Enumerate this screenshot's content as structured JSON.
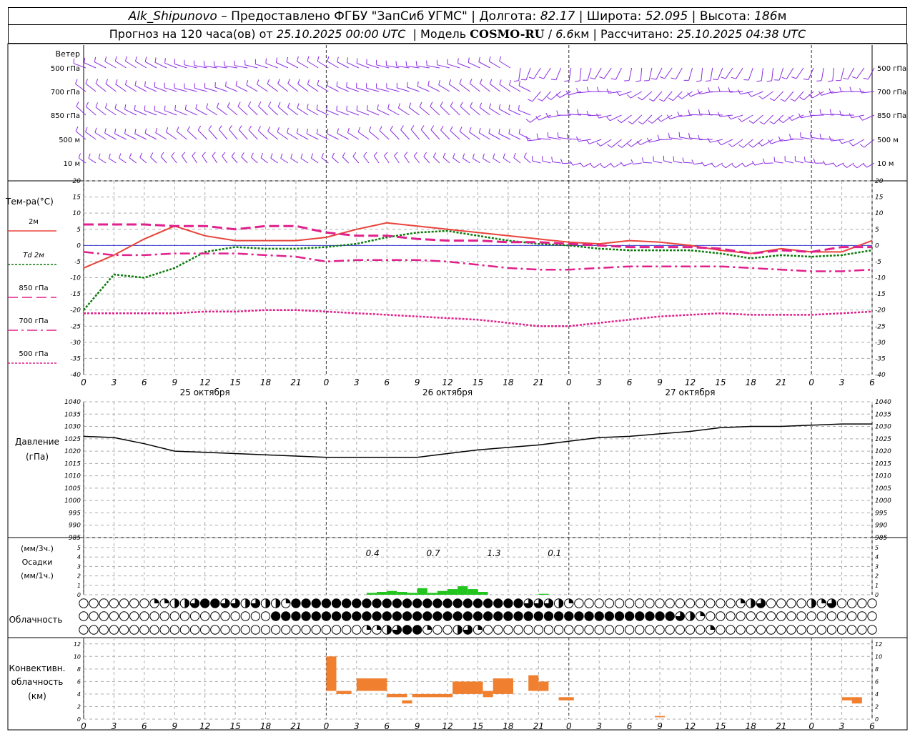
{
  "header": {
    "station": "Alk_Shipunovo",
    "provider_sep": "–",
    "provider": "Предоставлено ФГБУ \"ЗапСиб УГМС\"",
    "lon_label": "Долгота:",
    "lon_value": "82.17",
    "lat_label": "Широта:",
    "lat_value": "52.095",
    "alt_label": "Высота:",
    "alt_value": "186",
    "alt_unit": "м",
    "forecast_prefix": "Прогноз на 120 часа(ов) от",
    "forecast_time": "25.10.2025 00:00 UTC",
    "model_label": "Модель",
    "model_name": "COSMO-RU",
    "model_res": "6.6",
    "model_res_unit": "км",
    "calc_label": "Рассчитано:",
    "calc_time": "25.10.2025 04:38 UTC"
  },
  "wind_panel": {
    "title": "Ветер",
    "levels": [
      "500 гПа",
      "700 гПа",
      "850 гПа",
      "500 м",
      "10 м"
    ],
    "color": "#8a2be2"
  },
  "temp_panel": {
    "title": "Тем-ра(°C)",
    "yticks": [
      20,
      15,
      10,
      5,
      0,
      -5,
      -10,
      -15,
      -20,
      -25,
      -30,
      -35,
      -40
    ],
    "legend": [
      {
        "label": "2м",
        "color": "#e8433a",
        "dash": "solid"
      },
      {
        "label": "Td 2м",
        "color": "#0a7a0a",
        "dash": "dot"
      },
      {
        "label": "850 гПа",
        "color": "#e0208c",
        "dash": "dash"
      },
      {
        "label": "700 гПа",
        "color": "#e0208c",
        "dash": "dashdot"
      },
      {
        "label": "500 гПа",
        "color": "#e0208c",
        "dash": "dense"
      }
    ]
  },
  "time_axis": {
    "ticks": [
      "0",
      "3",
      "6",
      "9",
      "12",
      "15",
      "18",
      "21",
      "0",
      "3",
      "6",
      "9",
      "12",
      "15",
      "18",
      "21",
      "0",
      "3",
      "6",
      "9",
      "12",
      "15",
      "18",
      "21",
      "0",
      "3",
      "6"
    ],
    "dates": [
      "25 октября",
      "26 октября",
      "27 октября"
    ]
  },
  "pressure_panel": {
    "title": "Давление",
    "unit": "(гПа)",
    "yticks": [
      1040,
      1035,
      1030,
      1025,
      1020,
      1015,
      1010,
      1005,
      1000,
      995,
      990,
      985
    ]
  },
  "precip_panel": {
    "unit3h": "(мм/3ч.)",
    "title": "Осадки",
    "unit1h": "(мм/1ч.)",
    "yticks": [
      5,
      4,
      3,
      2,
      1,
      0
    ],
    "totals": [
      "0.4",
      "0.7",
      "1.3",
      "0.1"
    ],
    "color": "#22c41e"
  },
  "cloud_panel": {
    "title": "Облачность"
  },
  "conv_panel": {
    "title1": "Конвективн.",
    "title2": "облачность",
    "unit": "(км)",
    "yticks": [
      12,
      10,
      8,
      6,
      4,
      2,
      0
    ],
    "color": "#f08030"
  },
  "chart_data": {
    "type": "line",
    "x_hours": [
      0,
      3,
      6,
      9,
      12,
      15,
      18,
      21,
      24,
      27,
      30,
      33,
      36,
      39,
      42,
      45,
      48,
      51,
      54,
      57,
      60,
      63,
      66,
      69,
      72,
      75,
      78
    ],
    "series": [
      {
        "name": "2м",
        "values": [
          -7,
          -3,
          2,
          6,
          3,
          1.5,
          1.5,
          1.5,
          2.5,
          5,
          7,
          6,
          5,
          4,
          3,
          2,
          1,
          0.5,
          1.5,
          1,
          0,
          -1.5,
          -2.5,
          -1,
          -2,
          -2,
          1.5
        ]
      },
      {
        "name": "Td 2м",
        "values": [
          -20,
          -9,
          -10,
          -7,
          -2,
          -0.5,
          -1,
          -1,
          -0.5,
          0.5,
          2.5,
          4,
          4.5,
          3,
          1.5,
          0.5,
          0,
          -1,
          -1.5,
          -1.5,
          -1.5,
          -2.5,
          -4,
          -3,
          -3.5,
          -3,
          -1.5
        ]
      },
      {
        "name": "850 гПа",
        "values": [
          6.5,
          6.5,
          6.5,
          6,
          6,
          5,
          6,
          6,
          4,
          3,
          3,
          2,
          1.5,
          1.5,
          1,
          1,
          0.5,
          0,
          -0.5,
          -0.5,
          -0.5,
          -1,
          -2.5,
          -1.5,
          -2,
          -0.5,
          -0.5
        ]
      },
      {
        "name": "700 гПа",
        "values": [
          -2,
          -3,
          -3,
          -2.5,
          -2.5,
          -2.5,
          -3,
          -3.5,
          -5,
          -4.5,
          -4.5,
          -4.5,
          -5,
          -6,
          -7,
          -7.5,
          -7.5,
          -7,
          -6.5,
          -6.5,
          -6.5,
          -6.5,
          -7,
          -7.5,
          -8,
          -8,
          -7.5
        ]
      },
      {
        "name": "500 гПа",
        "values": [
          -21,
          -21,
          -21,
          -21,
          -20.5,
          -20.5,
          -20,
          -20,
          -20.5,
          -21,
          -21.5,
          -22,
          -22.5,
          -23,
          -24,
          -25,
          -25,
          -24,
          -23,
          -22,
          -21.5,
          -21,
          -21.5,
          -21.5,
          -21.5,
          -21,
          -20.5
        ]
      },
      {
        "name": "Давление",
        "values": [
          1026,
          1025.5,
          1023,
          1020,
          1019.5,
          1019,
          1018.5,
          1018,
          1017.5,
          1017.5,
          1017.5,
          1017.5,
          1019,
          1020.5,
          1021.5,
          1022.5,
          1024,
          1025.5,
          1026,
          1027,
          1028,
          1029.5,
          1030,
          1030,
          1030.5,
          1031,
          1031
        ]
      }
    ],
    "precip_3h": [
      {
        "h": 30,
        "v": 0.4
      },
      {
        "h": 36,
        "v": 0.7
      },
      {
        "h": 42,
        "v": 1.3
      },
      {
        "h": 48,
        "v": 0.1
      }
    ],
    "precip_1h": [
      {
        "h": 28,
        "v": 0.2
      },
      {
        "h": 29,
        "v": 0.3
      },
      {
        "h": 30,
        "v": 0.4
      },
      {
        "h": 31,
        "v": 0.3
      },
      {
        "h": 32,
        "v": 0.2
      },
      {
        "h": 33,
        "v": 0.7
      },
      {
        "h": 34,
        "v": 0.2
      },
      {
        "h": 35,
        "v": 0.4
      },
      {
        "h": 36,
        "v": 0.6
      },
      {
        "h": 37,
        "v": 0.9
      },
      {
        "h": 38,
        "v": 0.6
      },
      {
        "h": 39,
        "v": 0.3
      },
      {
        "h": 45,
        "v": 0.1
      }
    ],
    "convective_clouds": [
      {
        "h0": 24,
        "h1": 25,
        "base": 4.5,
        "top": 10
      },
      {
        "h0": 25,
        "h1": 26.5,
        "base": 4,
        "top": 4.5
      },
      {
        "h0": 27,
        "h1": 30,
        "base": 4.5,
        "top": 6.5
      },
      {
        "h0": 30,
        "h1": 32,
        "base": 3.5,
        "top": 4
      },
      {
        "h0": 31.5,
        "h1": 32.5,
        "base": 2.5,
        "top": 3
      },
      {
        "h0": 32.5,
        "h1": 36.5,
        "base": 3.5,
        "top": 4
      },
      {
        "h0": 36.5,
        "h1": 39.5,
        "base": 4,
        "top": 6
      },
      {
        "h0": 39.5,
        "h1": 40.5,
        "base": 3.5,
        "top": 4.5
      },
      {
        "h0": 40.5,
        "h1": 42.5,
        "base": 4,
        "top": 6.5
      },
      {
        "h0": 44,
        "h1": 45,
        "base": 4.5,
        "top": 7
      },
      {
        "h0": 45,
        "h1": 46,
        "base": 4.5,
        "top": 6
      },
      {
        "h0": 47,
        "h1": 48.5,
        "base": 3,
        "top": 3.5
      },
      {
        "h0": 56.5,
        "h1": 57.5,
        "base": 0.3,
        "top": 0.5
      },
      {
        "h0": 75,
        "h1": 76,
        "base": 3,
        "top": 3.5
      },
      {
        "h0": 76,
        "h1": 77,
        "base": 2.5,
        "top": 3.5
      }
    ],
    "cloud_rows": [
      "000000011223443323221444444444444444444444443332100000000000000001230000213000000000030",
      "000000000000000000044444444444444444444444444444444444444443210000000000000000000000002444444444431",
      "000000000000000000000000000011234410023100000000000000000000001000000000000000000000000000214344"
    ],
    "xlim": [
      0,
      78
    ],
    "ylim_temp": [
      -40,
      20
    ],
    "ylim_pressure": [
      985,
      1040
    ],
    "ylim_precip": [
      0,
      5
    ],
    "ylim_conv": [
      0,
      13
    ]
  }
}
